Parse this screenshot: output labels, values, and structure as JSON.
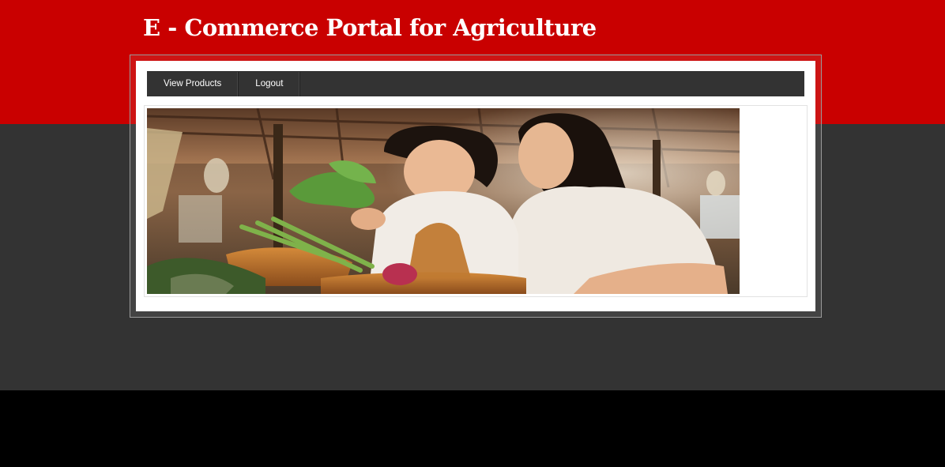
{
  "header": {
    "title": "E - Commerce Portal for Agriculture"
  },
  "nav": {
    "items": [
      {
        "label": "View Products"
      },
      {
        "label": "Logout"
      }
    ]
  },
  "hero": {
    "alt": "Two women shopping for vegetables at a market"
  },
  "colors": {
    "header_red": "#c90000",
    "body_grey": "#333333",
    "footer_black": "#000000",
    "nav_bg": "#333333"
  }
}
